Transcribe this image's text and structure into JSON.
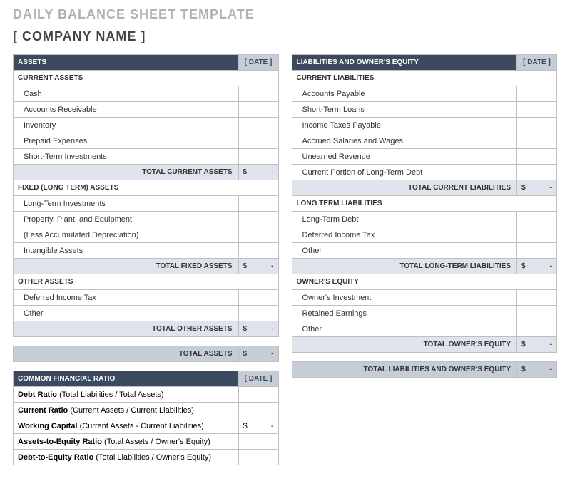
{
  "title": "DAILY BALANCE SHEET TEMPLATE",
  "company": "[ COMPANY NAME ]",
  "date_placeholder": "[ DATE ]",
  "currency": "$",
  "dash": "-",
  "assets": {
    "header": "ASSETS",
    "sections": [
      {
        "title": "CURRENT ASSETS",
        "items": [
          "Cash",
          "Accounts Receivable",
          "Inventory",
          "Prepaid Expenses",
          "Short-Term Investments"
        ],
        "total_label": "TOTAL CURRENT ASSETS"
      },
      {
        "title": "FIXED (LONG TERM) ASSETS",
        "items": [
          "Long-Term Investments",
          "Property, Plant, and Equipment",
          "(Less Accumulated Depreciation)",
          "Intangible Assets"
        ],
        "total_label": "TOTAL FIXED ASSETS"
      },
      {
        "title": "OTHER ASSETS",
        "items": [
          "Deferred Income Tax",
          "Other"
        ],
        "total_label": "TOTAL OTHER ASSETS"
      }
    ],
    "grand_total": "TOTAL ASSETS"
  },
  "liabilities": {
    "header": "LIABILITIES AND OWNER'S EQUITY",
    "sections": [
      {
        "title": "CURRENT LIABILITIES",
        "items": [
          "Accounts Payable",
          "Short-Term Loans",
          "Income Taxes Payable",
          "Accrued Salaries and Wages",
          "Unearned Revenue",
          "Current Portion of Long-Term Debt"
        ],
        "total_label": "TOTAL CURRENT LIABILITIES"
      },
      {
        "title": "LONG TERM LIABILITIES",
        "items": [
          "Long-Term Debt",
          "Deferred Income Tax",
          "Other"
        ],
        "total_label": "TOTAL LONG-TERM LIABILITIES"
      },
      {
        "title": "OWNER'S EQUITY",
        "items": [
          "Owner's Investment",
          "Retained Earnings",
          "Other"
        ],
        "total_label": "TOTAL OWNER'S EQUITY"
      }
    ],
    "grand_total": "TOTAL LIABILITIES AND OWNER'S EQUITY"
  },
  "ratios": {
    "header": "COMMON FINANCIAL RATIO",
    "items": [
      {
        "label": "Debt Ratio",
        "desc": "(Total Liabilities / Total Assets)",
        "has_value": false
      },
      {
        "label": "Current Ratio",
        "desc": "(Current Assets / Current Liabilities)",
        "has_value": false
      },
      {
        "label": "Working Capital",
        "desc": "(Current Assets - Current Liabilities)",
        "has_value": true
      },
      {
        "label": "Assets-to-Equity Ratio",
        "desc": "(Total Assets / Owner's Equity)",
        "has_value": false
      },
      {
        "label": "Debt-to-Equity Ratio",
        "desc": "(Total Liabilities / Owner's Equity)",
        "has_value": false
      }
    ]
  }
}
